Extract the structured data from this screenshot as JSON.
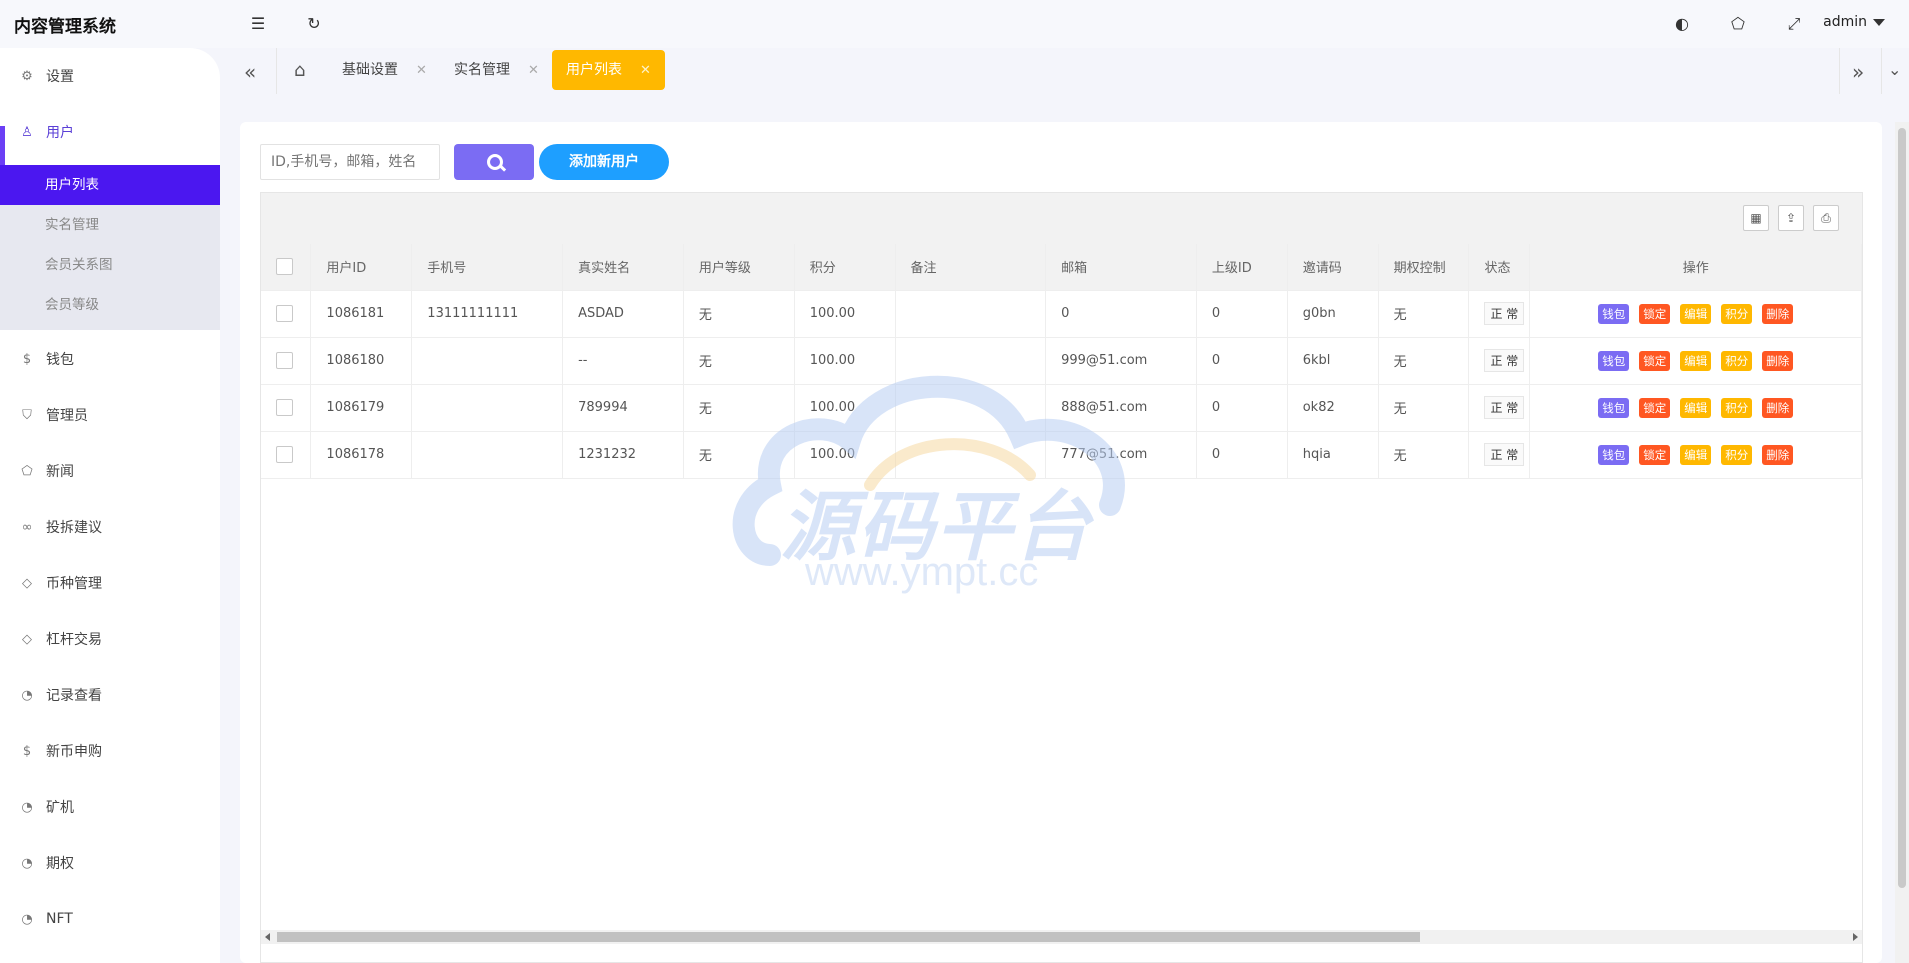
{
  "app": {
    "title": "内容管理系统"
  },
  "user": {
    "name": "admin"
  },
  "sidebar": {
    "items": [
      {
        "label": "设置",
        "icon": "gear-icon"
      },
      {
        "label": "用户",
        "icon": "user-icon"
      },
      {
        "label": "钱包",
        "icon": "coin-icon"
      },
      {
        "label": "管理员",
        "icon": "shield-check-icon"
      },
      {
        "label": "新闻",
        "icon": "tag-icon"
      },
      {
        "label": "投拆建议",
        "icon": "link-icon"
      },
      {
        "label": "币种管理",
        "icon": "diamond-icon"
      },
      {
        "label": "杠杆交易",
        "icon": "diamond-icon"
      },
      {
        "label": "记录查看",
        "icon": "clock-icon"
      },
      {
        "label": "新币申购",
        "icon": "coin-icon"
      },
      {
        "label": "矿机",
        "icon": "clock-icon"
      },
      {
        "label": "期权",
        "icon": "clock-icon"
      },
      {
        "label": "NFT",
        "icon": "clock-icon"
      }
    ],
    "submenu": [
      "用户列表",
      "实名管理",
      "会员关系图",
      "会员等级"
    ]
  },
  "tabs": [
    {
      "label": "基础设置"
    },
    {
      "label": "实名管理"
    },
    {
      "label": "用户列表"
    }
  ],
  "search": {
    "placeholder": "ID,手机号，邮箱，姓名",
    "add_label": "添加新用户"
  },
  "table": {
    "columns": [
      "用户ID",
      "手机号",
      "真实姓名",
      "用户等级",
      "积分",
      "备注",
      "邮箱",
      "上级ID",
      "邀请码",
      "期权控制",
      "状态",
      "操作"
    ],
    "rows": [
      {
        "id": "1086181",
        "phone": "13111111111",
        "name": "ASDAD",
        "level": "无",
        "points": "100.00",
        "note": "",
        "email": "0",
        "parent": "0",
        "invite": "g0bn",
        "option": "无",
        "status": "正 常"
      },
      {
        "id": "1086180",
        "phone": "",
        "name": "--",
        "level": "无",
        "points": "100.00",
        "note": "",
        "email": "999@51.com",
        "parent": "0",
        "invite": "6kbl",
        "option": "无",
        "status": "正 常"
      },
      {
        "id": "1086179",
        "phone": "",
        "name": "789994",
        "level": "无",
        "points": "100.00",
        "note": "",
        "email": "888@51.com",
        "parent": "0",
        "invite": "ok82",
        "option": "无",
        "status": "正 常"
      },
      {
        "id": "1086178",
        "phone": "",
        "name": "1231232",
        "level": "无",
        "points": "100.00",
        "note": "",
        "email": "777@51.com",
        "parent": "0",
        "invite": "hqia",
        "option": "无",
        "status": "正 常"
      }
    ],
    "actions": [
      {
        "label": "钱包",
        "color": "#7b6cf3"
      },
      {
        "label": "锁定",
        "color": "#ff5722"
      },
      {
        "label": "编辑",
        "color": "#ffb800"
      },
      {
        "label": "积分",
        "color": "#ffb800"
      },
      {
        "label": "删除",
        "color": "#ff5722"
      }
    ]
  },
  "watermark": {
    "main": "源码平台",
    "url": "www.ympt.cc"
  },
  "colors": {
    "accent": "#4b17f0",
    "tab_active": "#ffb800",
    "add_button": "#1e9fff",
    "search_button": "#7b6cf3"
  }
}
